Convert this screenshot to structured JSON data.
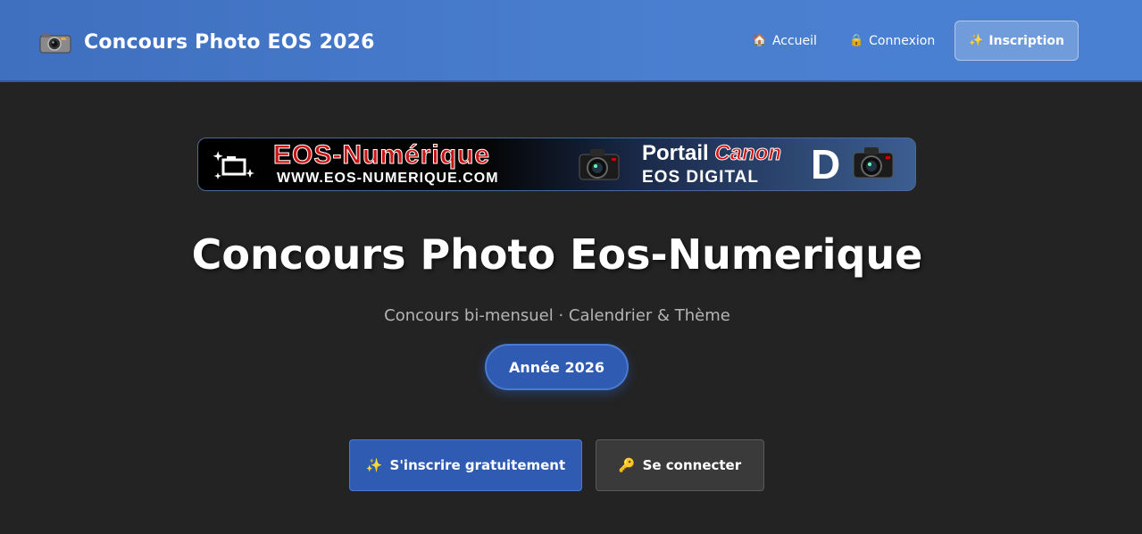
{
  "header": {
    "brand_icon": "camera-icon",
    "brand_title": "Concours Photo EOS 2026",
    "nav": [
      {
        "icon": "🏠",
        "label": "Accueil"
      },
      {
        "icon": "🔒",
        "label": "Connexion"
      },
      {
        "icon": "✨",
        "label": "Inscription"
      }
    ]
  },
  "banner": {
    "line1": "EOS-Numérique",
    "line2": "WWW.EOS-NUMERIQUE.COM",
    "portal": "Portail",
    "brand": "Canon",
    "line3": "EOS DIGITAL",
    "letter": "D"
  },
  "hero": {
    "title": "Concours Photo Eos-Numerique",
    "subtitle": "Concours bi-mensuel · Calendrier & Thème",
    "year_badge": "Année 2026"
  },
  "actions": {
    "signup_icon": "✨",
    "signup_label": "S'inscrire gratuitement",
    "login_icon": "🔑",
    "login_label": "Se connecter"
  },
  "colors": {
    "header": "#4a7fd0",
    "background": "#232323",
    "primary": "#2f5bb3",
    "secondary": "#3a3a3a"
  }
}
